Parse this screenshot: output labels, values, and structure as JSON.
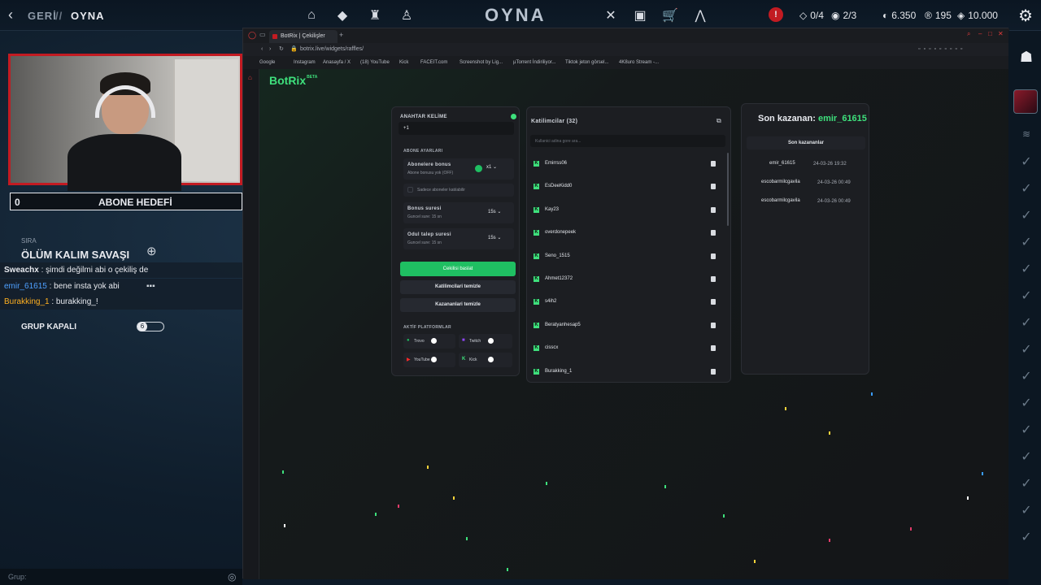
{
  "topbar": {
    "back_label": "GERİ",
    "separator": "//",
    "current_label": "OYNA",
    "title": "OYNA",
    "alert": "!",
    "party_count": "0/4",
    "squad_count": "2/3",
    "valorant_points": "6.350",
    "radianite": "195",
    "kingdom_credits": "10.000"
  },
  "webcam": {
    "goal_count": "0",
    "goal_label": "ABONE HEDEFİ"
  },
  "left_panel": {
    "queue_label": "SIRA",
    "mode_title": "ÖLÜM KALIM SAVAŞI",
    "group_status": "GRUP KAPALI",
    "group_toggle_value": "6",
    "group_input_placeholder": "Grup:"
  },
  "chat": [
    {
      "user": "Sweachx",
      "message": " : şimdi değilmi abi o çekiliş de",
      "color": "#e6e8ec"
    },
    {
      "user": "emir_61615",
      "message": " : bene insta yok abi",
      "color": "#4ea0ff"
    },
    {
      "user": "Burakking_1",
      "message": " : burakking_!",
      "color": "#ffb020"
    }
  ],
  "browser": {
    "tab_title": "BotRix | Çekilişler",
    "url": "botrix.live/widgets/raffles/",
    "bookmarks": [
      "Google",
      "Instagram",
      "Anasayfa / X",
      "(18) YouTube",
      "Kick",
      "FACEIT.com",
      "Screenshot by Lig...",
      "µTorrent İndiriliyor...",
      "Tiktok jeton görsel...",
      "4K8uro Stream -..."
    ]
  },
  "botrix": {
    "logo": "BotRix",
    "beta": "BETA",
    "keyword_label": "ANAHTAR KELİME",
    "keyword_value": "+1",
    "sub_settings_label": "ABONE AYARLARI",
    "sub_bonus_title": "Abonelere bonus",
    "sub_bonus_desc": "Abone bonusu yok (OFF)",
    "sub_bonus_multiplier": "x1",
    "sub_only_label": "Sadece aboneler katılabilir",
    "bonus_time_title": "Bonus suresi",
    "bonus_time_desc": "Guncel sure: 15 sn",
    "bonus_time_value": "15s",
    "claim_time_title": "Odul talep suresi",
    "claim_time_desc": "Guncel sure: 15 sn",
    "claim_time_value": "15s",
    "start_button": "Cekilisi baslat",
    "clear_participants": "Katilimcilari temizle",
    "clear_winners": "Kazananlari temizle",
    "platforms_label": "AKTİF PLATFORMLAR",
    "platforms": [
      "Trovo",
      "Twitch",
      "YouTube",
      "Kick"
    ],
    "participants_title": "Katilimcilar (32)",
    "participants_search_placeholder": "Kullanici adina gore ara...",
    "participants": [
      "Emirrss06",
      "EsDeeKidd0",
      "Kay23",
      "overdonepeek",
      "Seno_1515",
      "Ahmet12372",
      "s4ih2",
      "Beratyanhesap5",
      "cisscx",
      "Burakking_1"
    ],
    "last_winner_label": "Son kazanan:",
    "last_winner_name": "emir_61615",
    "winners_title": "Son kazananlar",
    "winners": [
      {
        "name": "emir_61615",
        "time": "24-03-26 19:32"
      },
      {
        "name": "escobarmilcgavila",
        "time": "24-03-26 00:49"
      },
      {
        "name": "escobarmilcgavila",
        "time": "24-03-26 00:49"
      }
    ]
  },
  "colors": {
    "accent_green": "#1fbf62",
    "brand_red": "#c21b22",
    "bg_dark": "#0e1a26"
  }
}
